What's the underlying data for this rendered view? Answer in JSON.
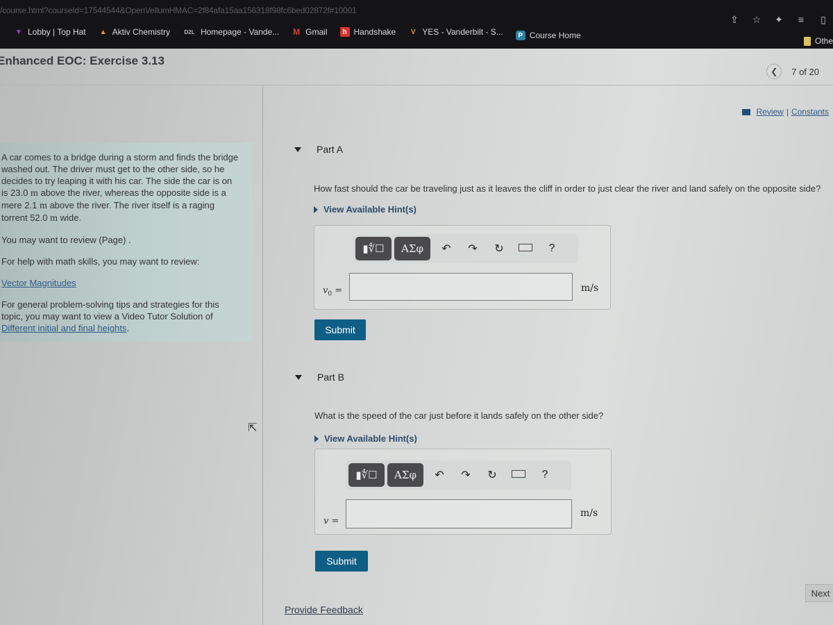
{
  "browser": {
    "url": "/course.html?courseId=17544544&OpenVellumHMAC=2f84afa15aa156318f98fc6bed02872f#10001",
    "bookmarks": [
      {
        "label": "Lobby | Top Hat",
        "icon": "tophat-icon",
        "color": "#7b2fa8"
      },
      {
        "label": "Aktiv Chemistry",
        "icon": "aktiv-icon",
        "color": "#c94a2e"
      },
      {
        "label": "Homepage - Vande...",
        "icon": "d2l-icon",
        "color": "#cfcfcf"
      },
      {
        "label": "Gmail",
        "icon": "gmail-icon",
        "color": "#d64537"
      },
      {
        "label": "Handshake",
        "icon": "handshake-icon",
        "color": "#d6322f"
      },
      {
        "label": "YES - Vanderbilt - S...",
        "icon": "vanderbilt-icon",
        "color": "#b8962e"
      },
      {
        "label": "Course Home",
        "icon": "pearson-icon",
        "color": "#2d7fa5"
      }
    ],
    "other_bookmarks": "Othe"
  },
  "page": {
    "title": "Enhanced EOC: Exercise 3.13",
    "pagination": "7 of 20",
    "review_label": "Review",
    "separator": "|",
    "constants_label": "Constants",
    "next_label": "Next"
  },
  "intro": {
    "problem_pre": "A car comes to a bridge during a storm and finds the bridge washed out. The driver must get to the other side, so he decides to try leaping it with his car. The side the car is on is ",
    "h1": "23.0",
    "mid1": " above the river, whereas the opposite side is a mere ",
    "h2": "2.1",
    "mid2": " above the river. The river itself is a raging torrent ",
    "width": "52.0",
    "end": " wide.",
    "unit": "m",
    "review_page": "You may want to review (Page) .",
    "math_help": "For help with math skills, you may want to review:",
    "math_link": "Vector Magnitudes",
    "tips_pre": "For general problem-solving tips and strategies for this topic, you may want to view a Video Tutor Solution of ",
    "tips_link": "Different initial and final heights",
    "tips_end": "."
  },
  "parts": [
    {
      "label": "Part A",
      "question": "How fast should the car be traveling just as it leaves the cliff in order to just clear the river and land safely on the opposite side?",
      "hint": "View Available Hint(s)",
      "var": "v",
      "var_sub": "0",
      "equals": " =",
      "value": "",
      "units": "m/s",
      "submit": "Submit"
    },
    {
      "label": "Part B",
      "question": "What is the speed of the car just before it lands safely on the other side?",
      "hint": "View Available Hint(s)",
      "var": "v",
      "var_sub": "",
      "equals": " =",
      "value": "",
      "units": "m/s",
      "submit": "Submit"
    }
  ],
  "math_toolbar": {
    "templates": "▮∜☐",
    "greek": "ΑΣφ",
    "undo": "↶",
    "redo": "↷",
    "reset": "↻",
    "help": "?"
  },
  "footer": {
    "feedback": "Provide Feedback"
  }
}
